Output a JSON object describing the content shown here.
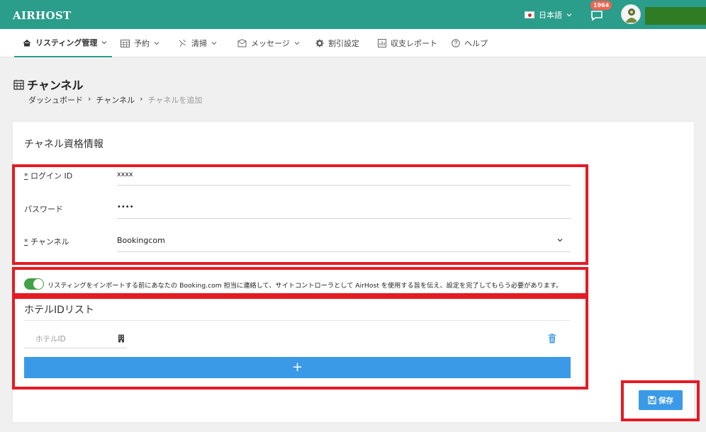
{
  "app": {
    "logo": "AIRHOST"
  },
  "topbar": {
    "language": "日本語",
    "notification_count": "1964"
  },
  "nav": {
    "items": [
      {
        "label": "リスティング管理",
        "icon": "home-icon",
        "dropdown": true
      },
      {
        "label": "予約",
        "icon": "calendar-icon",
        "dropdown": true
      },
      {
        "label": "清掃",
        "icon": "cleaning-icon",
        "dropdown": true
      },
      {
        "label": "メッセージ",
        "icon": "message-icon",
        "dropdown": true
      },
      {
        "label": "割引設定",
        "icon": "gear-icon",
        "dropdown": false
      },
      {
        "label": "収支レポート",
        "icon": "report-icon",
        "dropdown": false
      },
      {
        "label": "ヘルプ",
        "icon": "help-icon",
        "dropdown": false
      }
    ]
  },
  "page": {
    "title": "チャンネル",
    "breadcrumb": [
      "ダッシュボード",
      "チャンネル",
      "チャネルを追加"
    ]
  },
  "form": {
    "section_title": "チャネル資格情報",
    "login_id": {
      "required_mark": "*",
      "label": "ログイン ID",
      "value": "xxxx"
    },
    "password": {
      "label": "パスワード",
      "value": "••••"
    },
    "channel": {
      "required_mark": "*",
      "label": "チャンネル",
      "value": "Bookingcom"
    },
    "notice": "リスティングをインポートする前にあなたの Booking.com 担当に連絡して、サイトコントローラとして AirHost を使用する旨を伝え、設定を完了してもらう必要があります。",
    "notice_toggle_on": true
  },
  "hotel_list": {
    "title": "ホテルIDリスト",
    "field_placeholder": "ホテルID",
    "add_label": "+"
  },
  "actions": {
    "save_label": "保存"
  },
  "colors": {
    "header_bg": "#2a9d8b",
    "primary_button": "#3b9ae8",
    "highlight_box": "#e41b23",
    "toggle_on": "#43a047"
  }
}
